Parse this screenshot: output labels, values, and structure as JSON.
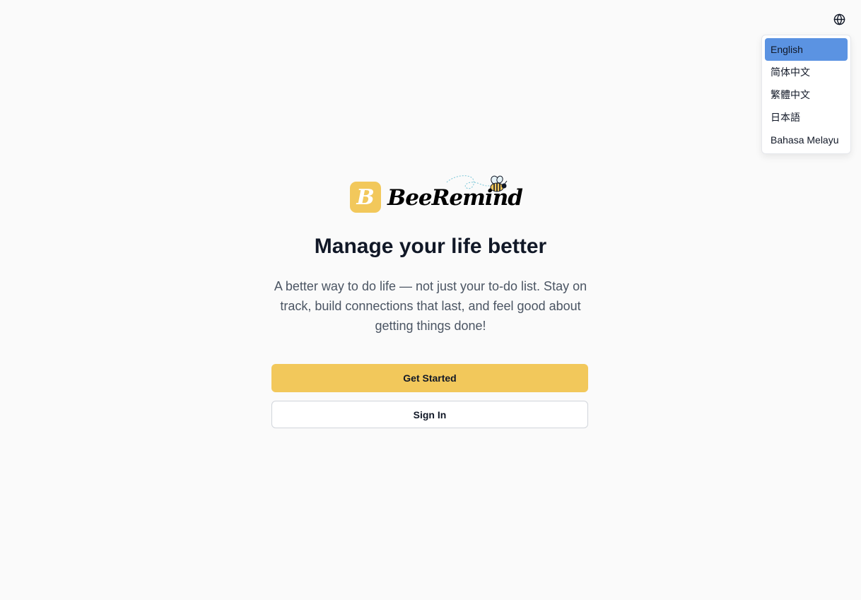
{
  "header": {
    "language_icon": "globe-icon"
  },
  "language_menu": {
    "items": [
      {
        "label": "English",
        "selected": true
      },
      {
        "label": "简体中文",
        "selected": false
      },
      {
        "label": "繁體中文",
        "selected": false
      },
      {
        "label": "日本語",
        "selected": false
      },
      {
        "label": "Bahasa Melayu",
        "selected": false
      }
    ]
  },
  "brand": {
    "name": "BeeRemind",
    "badge_letter": "B",
    "logo_icon": "bee-icon",
    "accent_color": "#f2c85b"
  },
  "hero": {
    "title": "Manage your life better",
    "subtitle": "A better way to do life — not just your to-do list. Stay on track, build connections that last, and feel good about getting things done!"
  },
  "actions": {
    "primary_label": "Get Started",
    "secondary_label": "Sign In"
  },
  "colors": {
    "background": "#fafafa",
    "selected_item": "#5b93e2",
    "primary_button": "#f2c85b"
  }
}
